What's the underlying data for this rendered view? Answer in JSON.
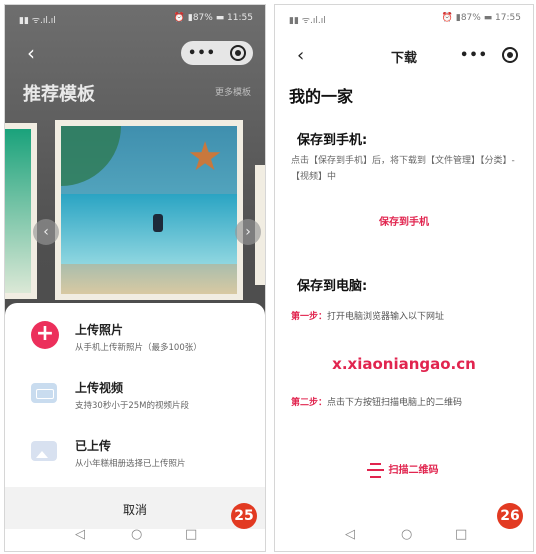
{
  "left": {
    "status_left": "▮▮ ᯤ.ıl.ıl",
    "status_right": "⏰ ▮87% ▬ 11:55",
    "back": "‹",
    "more": "•••",
    "title": "推荐模板",
    "more_link": "更多模板",
    "prev_arrow": "‹",
    "next_arrow": "›",
    "sheet": {
      "photo": {
        "title": "上传照片",
        "desc": "从手机上传新照片（最多100张）",
        "icon": "+"
      },
      "video": {
        "title": "上传视频",
        "desc": "支持30秒小于25M的视频片段"
      },
      "uploaded": {
        "title": "已上传",
        "desc": "从小年糕相册选择已上传照片"
      },
      "cancel": "取消"
    },
    "nav": {
      "back": "◁",
      "home": "○",
      "recent": "□"
    },
    "badge": "25"
  },
  "right": {
    "status_left": "▮▮ ᯤ.ıl.ıl",
    "status_right": "⏰ ▮87% ▬ 17:55",
    "back": "‹",
    "title": "下载",
    "more": "•••",
    "h1": "我的一家",
    "save_phone_heading": "保存到手机:",
    "save_phone_desc": "点击【保存到手机】后，将下载到【文件管理】【分类】-【视频】中",
    "save_phone_btn": "保存到手机",
    "save_pc_heading": "保存到电脑:",
    "step1_label": "第一步：",
    "step1_text": "打开电脑浏览器输入以下网址",
    "url": "x.xiaoniangao.cn",
    "step2_label": "第二步：",
    "step2_text": "点击下方按钮扫描电脑上的二维码",
    "scan_btn": "扫描二维码",
    "nav": {
      "back": "◁",
      "home": "○",
      "recent": "□"
    },
    "badge": "26"
  }
}
